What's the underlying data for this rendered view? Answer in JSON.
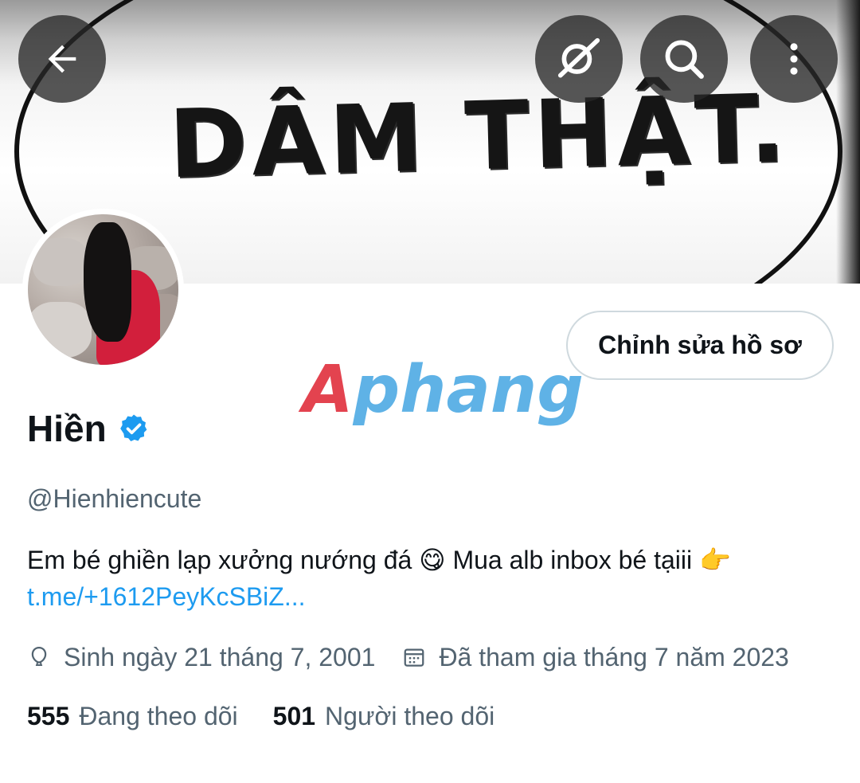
{
  "banner": {
    "text": "DÂM THẬT."
  },
  "toolbar": {
    "back_icon": "arrow-left-icon",
    "grok_icon": "grok-icon",
    "search_icon": "search-icon",
    "more_icon": "more-vertical-icon"
  },
  "profile": {
    "edit_label": "Chỉnh sửa hồ sơ",
    "name": "Hiền",
    "verified_color": "#1d9bf0",
    "handle": "@Hienhiencute",
    "bio_text": "Em bé ghiền lạp xưởng nướng đá 😋 Mua alb inbox bé tạiii 👉",
    "bio_link": "t.me/+1612PeyKcSBiZ...",
    "birthday": "Sinh ngày 21 tháng 7, 2001",
    "joined": "Đã tham gia tháng 7 năm 2023",
    "following_count": "555",
    "following_label": "Đang theo dõi",
    "followers_count": "501",
    "followers_label": "Người theo dõi"
  },
  "watermark": {
    "first": "A",
    "rest": "phang"
  },
  "colors": {
    "link": "#1d9bf0",
    "secondary_text": "#536471",
    "primary_text": "#0f1419"
  }
}
